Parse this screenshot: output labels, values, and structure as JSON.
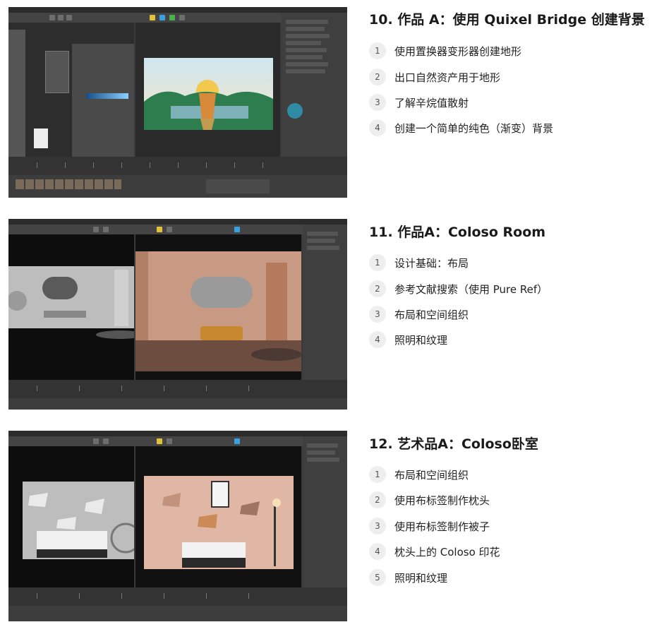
{
  "sections": [
    {
      "title": "10. 作品 A：使用 Quixel Bridge 创建背景",
      "screenshot_alt": "Cinema 4D Octane 节点编辑器与渲染窗口",
      "items": [
        {
          "num": "1",
          "text": "使用置换器变形器创建地形"
        },
        {
          "num": "2",
          "text": "出口自然资产用于地形"
        },
        {
          "num": "3",
          "text": "了解辛烷值散射"
        },
        {
          "num": "4",
          "text": "创建一个简单的纯色（渐变）背景"
        }
      ]
    },
    {
      "title": "11. 作品A：Coloso Room",
      "screenshot_alt": "Cinema 4D 视口与房间渲染",
      "items": [
        {
          "num": "1",
          "text": "设计基础：布局"
        },
        {
          "num": "2",
          "text": "参考文献搜索（使用 Pure Ref）"
        },
        {
          "num": "3",
          "text": "布局和空间组织"
        },
        {
          "num": "4",
          "text": "照明和纹理"
        }
      ]
    },
    {
      "title": "12. 艺术品A：Coloso卧室",
      "screenshot_alt": "Cinema 4D 视口与卧室渲染",
      "items": [
        {
          "num": "1",
          "text": "布局和空间组织"
        },
        {
          "num": "2",
          "text": "使用布标签制作枕头"
        },
        {
          "num": "3",
          "text": "使用布标签制作被子"
        },
        {
          "num": "4",
          "text": "枕头上的 Coloso 印花"
        },
        {
          "num": "5",
          "text": "照明和纹理"
        }
      ]
    }
  ],
  "colors": {
    "ui_dark": "#3a3a3a",
    "number_badge_bg": "#eeeeee",
    "render_sun": "#f2c94c",
    "render_hills": "#2e7d4f",
    "room_wall": "#c99a83",
    "bedroom_wall": "#e0b7a4"
  }
}
